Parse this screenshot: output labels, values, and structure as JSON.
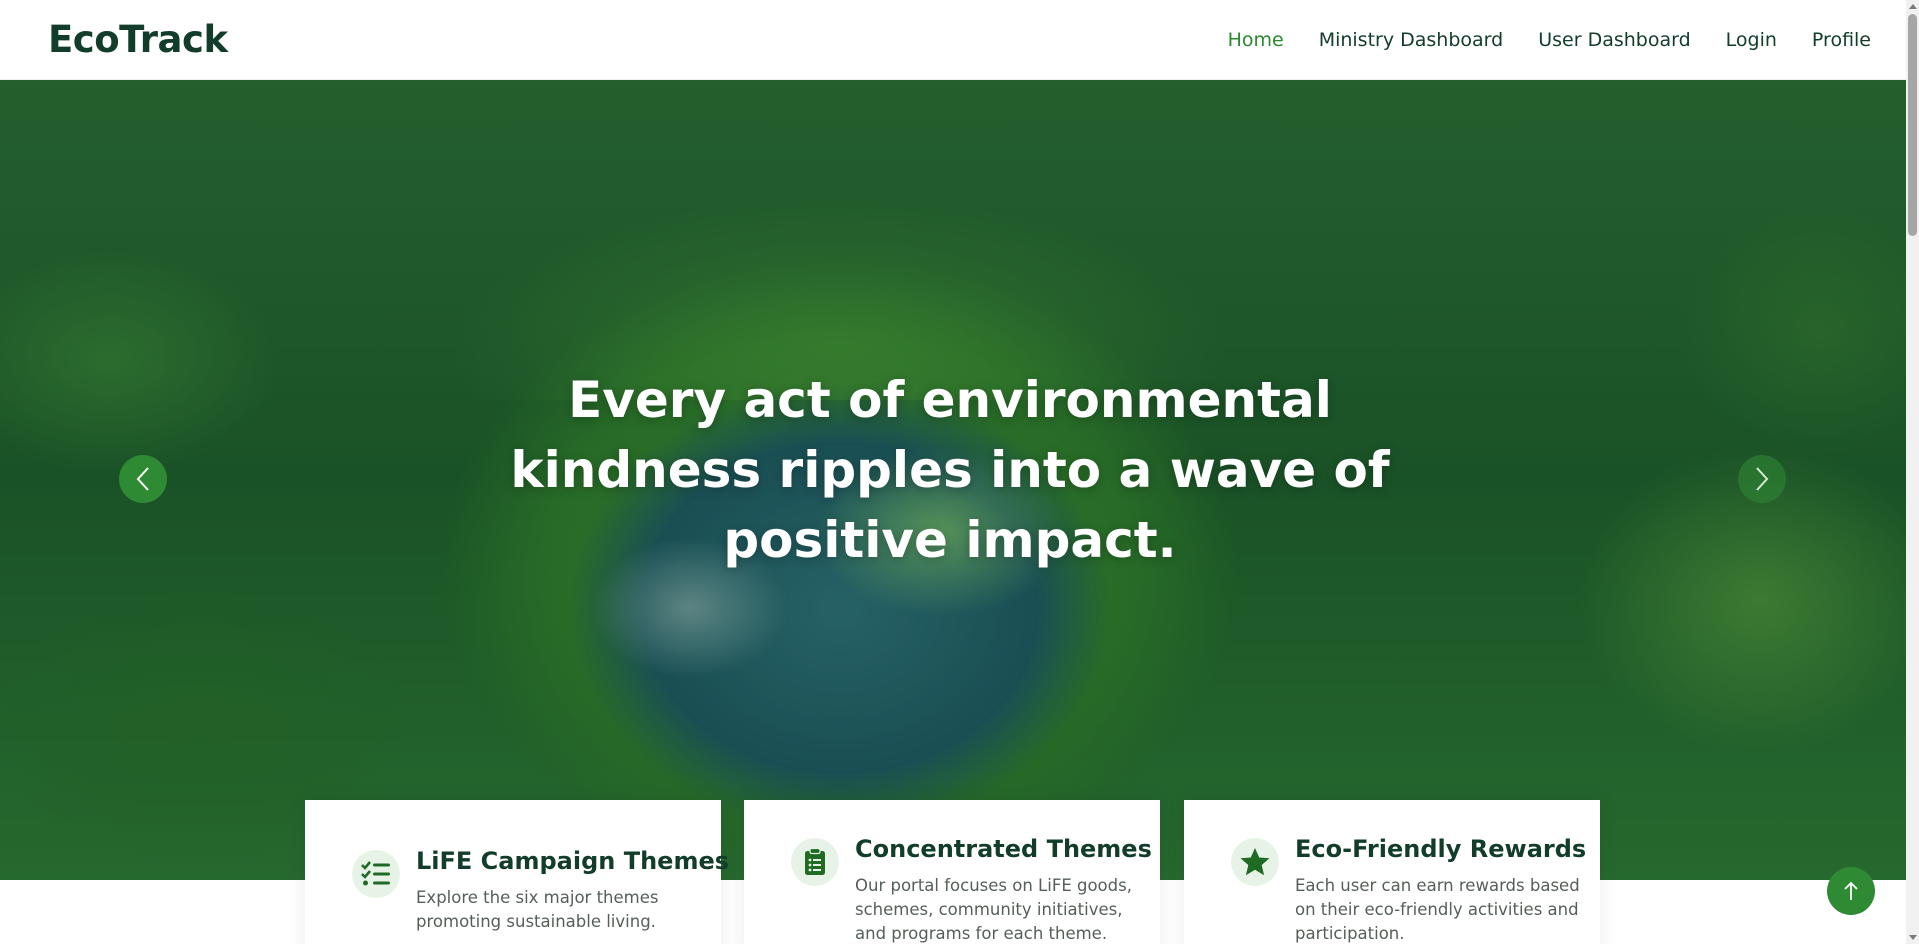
{
  "brand": {
    "name": "EcoTrack"
  },
  "nav": {
    "items": [
      {
        "label": "Home",
        "active": true
      },
      {
        "label": "Ministry Dashboard",
        "active": false
      },
      {
        "label": "User Dashboard",
        "active": false
      },
      {
        "label": "Login",
        "active": false
      },
      {
        "label": "Profile",
        "active": false
      }
    ]
  },
  "hero": {
    "title": "Every act of environmental kindness ripples into a wave of positive impact.",
    "prev_icon": "chevron-left-icon",
    "next_icon": "chevron-right-icon"
  },
  "features": [
    {
      "icon": "checklist-icon",
      "title": "LiFE Campaign Themes",
      "description": "Explore the six major themes promoting sustainable living."
    },
    {
      "icon": "clipboard-icon",
      "title": "Concentrated Themes",
      "description": "Our portal focuses on LiFE goods, schemes, community initiatives, and programs for each theme."
    },
    {
      "icon": "star-icon",
      "title": "Eco-Friendly Rewards",
      "description": "Each user can earn rewards based on their eco-friendly activities and participation."
    }
  ],
  "back_to_top_icon": "arrow-up-icon",
  "colors": {
    "brand_dark": "#123d2a",
    "accent_green": "#2f8a34",
    "active_link": "#2a8a2f",
    "icon_bg": "#e8f3e8"
  }
}
